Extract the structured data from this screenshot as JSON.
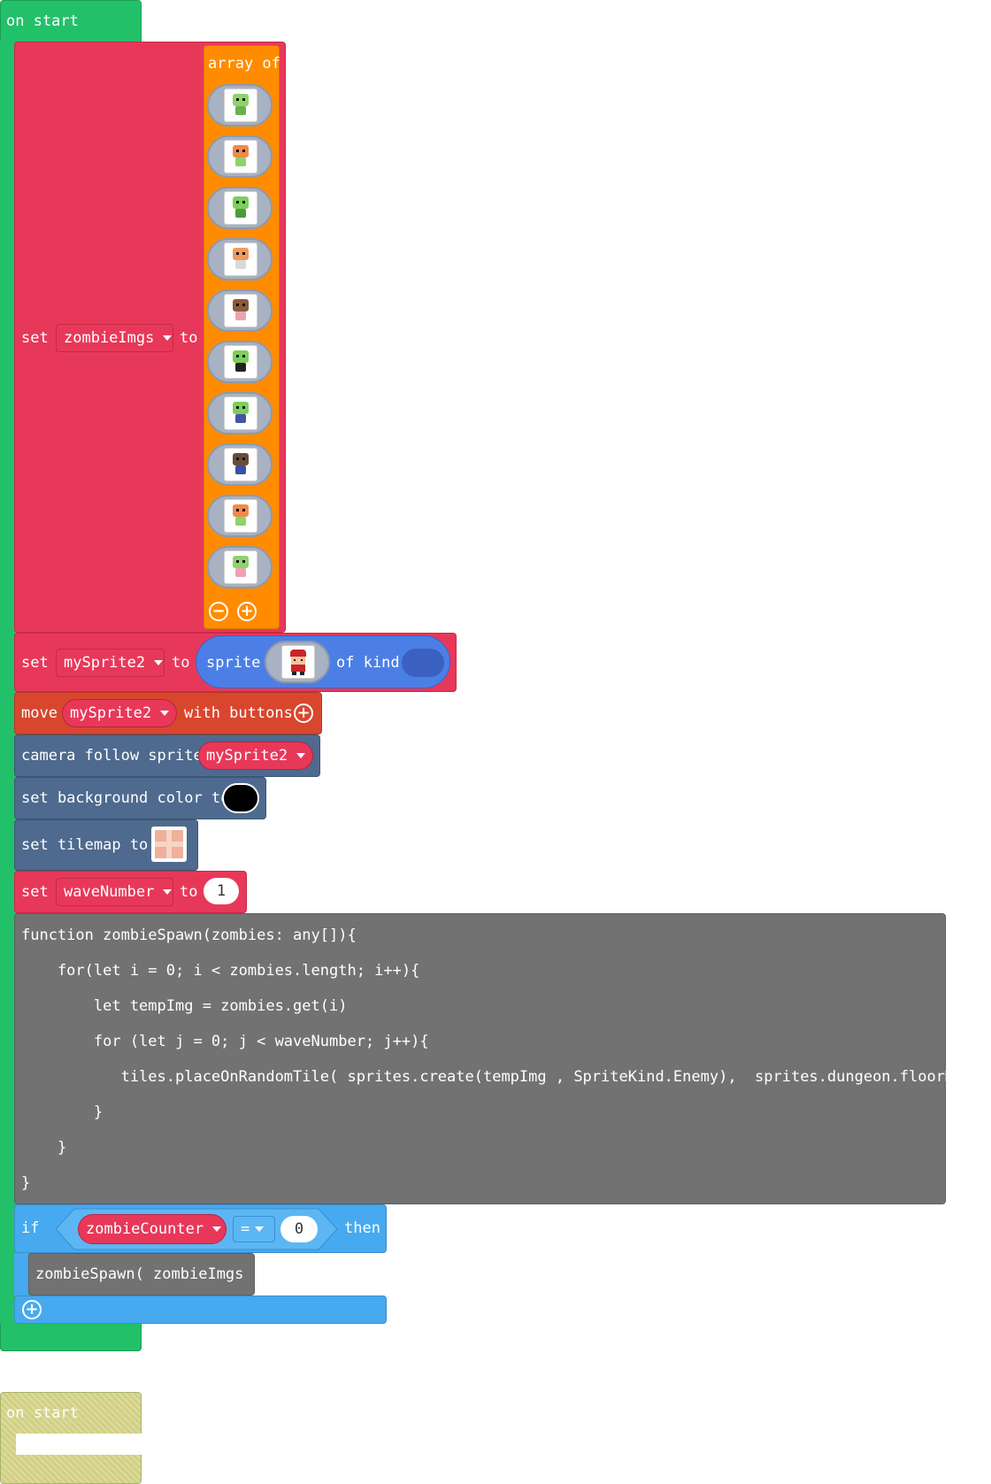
{
  "colors": {
    "on_start": "#23c06a",
    "variables": "#e8385a",
    "arrays": "#ff8c00",
    "sprites": "#4c7fe6",
    "controller": "#d9462e",
    "scene": "#4e6a8e",
    "javascript": "#727272",
    "logic": "#47a9ef",
    "disabled": "#d1cf82"
  },
  "on_start": {
    "label": "on start",
    "set_zombie_imgs": {
      "set": "set",
      "variable": "zombieImgs",
      "to": "to",
      "array_label": "array of",
      "images": [
        "zombie-1-icon",
        "zombie-2-icon",
        "zombie-3-icon",
        "zombie-4-icon",
        "zombie-5-icon",
        "zombie-6-icon",
        "zombie-7-icon",
        "zombie-8-icon",
        "zombie-9-icon",
        "zombie-10-icon"
      ]
    },
    "set_sprite": {
      "set": "set",
      "variable": "mySprite2",
      "to": "to",
      "sprite": "sprite",
      "of_kind": "of kind",
      "image": "player-sprite-icon"
    },
    "move": {
      "move": "move",
      "variable": "mySprite2",
      "with_buttons": "with buttons"
    },
    "camera": {
      "label": "camera follow sprite",
      "variable": "mySprite2"
    },
    "background": {
      "label": "set background color to",
      "color": "#000000"
    },
    "tilemap": {
      "label": "set tilemap to",
      "image": "tilemap-icon"
    },
    "set_wave": {
      "set": "set",
      "variable": "waveNumber",
      "to": "to",
      "value": "1"
    },
    "js_code": {
      "lines": [
        "function zombieSpawn(zombies: any[]){",
        "    for(let i = 0; i < zombies.length; i++){",
        "        let tempImg = zombies.get(i)",
        "        for (let j = 0; j < waveNumber; j++){",
        "           tiles.placeOnRandomTile( sprites.create(tempImg , SpriteKind.Enemy),  sprites.dungeon.floorMixed)",
        "        }",
        "    }",
        "}"
      ]
    },
    "if_block": {
      "if": "if",
      "variable": "zombieCounter",
      "operator": "=",
      "value": "0",
      "then": "then",
      "call": "zombieSpawn( zombieImgs )"
    }
  },
  "disabled_on_start": {
    "label": "on start"
  }
}
